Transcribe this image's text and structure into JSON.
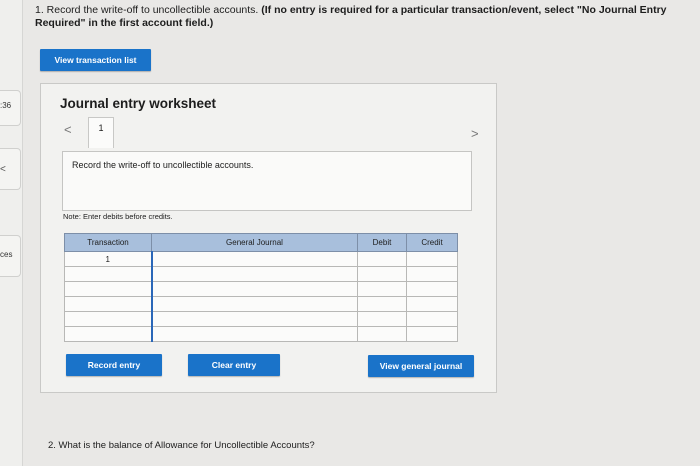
{
  "question1": {
    "prefix": "1. Record the write-off to uncollectible accounts. ",
    "instruction": "(If no entry is required for a particular transaction/event, select \"No Journal Entry Required\" in the first account field.)"
  },
  "sidebar": {
    "timer_fragment": ":36",
    "nav_arrow": "<",
    "resources_fragment": "ces"
  },
  "buttons": {
    "view_transaction_list": "View transaction list",
    "record_entry": "Record entry",
    "clear_entry": "Clear entry",
    "view_general_journal": "View general journal"
  },
  "worksheet": {
    "title": "Journal entry worksheet",
    "prev_arrow": "<",
    "next_arrow": ">",
    "current_tab": "1",
    "description": "Record the write-off to uncollectible accounts.",
    "note": "Note: Enter debits before credits."
  },
  "journal_table": {
    "headers": {
      "transaction": "Transaction",
      "general_journal": "General Journal",
      "debit": "Debit",
      "credit": "Credit"
    },
    "rows": [
      {
        "transaction": "1",
        "account": "",
        "debit": "",
        "credit": ""
      },
      {
        "transaction": "",
        "account": "",
        "debit": "",
        "credit": ""
      },
      {
        "transaction": "",
        "account": "",
        "debit": "",
        "credit": ""
      },
      {
        "transaction": "",
        "account": "",
        "debit": "",
        "credit": ""
      },
      {
        "transaction": "",
        "account": "",
        "debit": "",
        "credit": ""
      },
      {
        "transaction": "",
        "account": "",
        "debit": "",
        "credit": ""
      }
    ]
  },
  "question2": "2. What is the balance of Allowance for Uncollectible Accounts?",
  "colors": {
    "button_blue": "#1a73c9",
    "header_blue": "#a8bfdc"
  }
}
